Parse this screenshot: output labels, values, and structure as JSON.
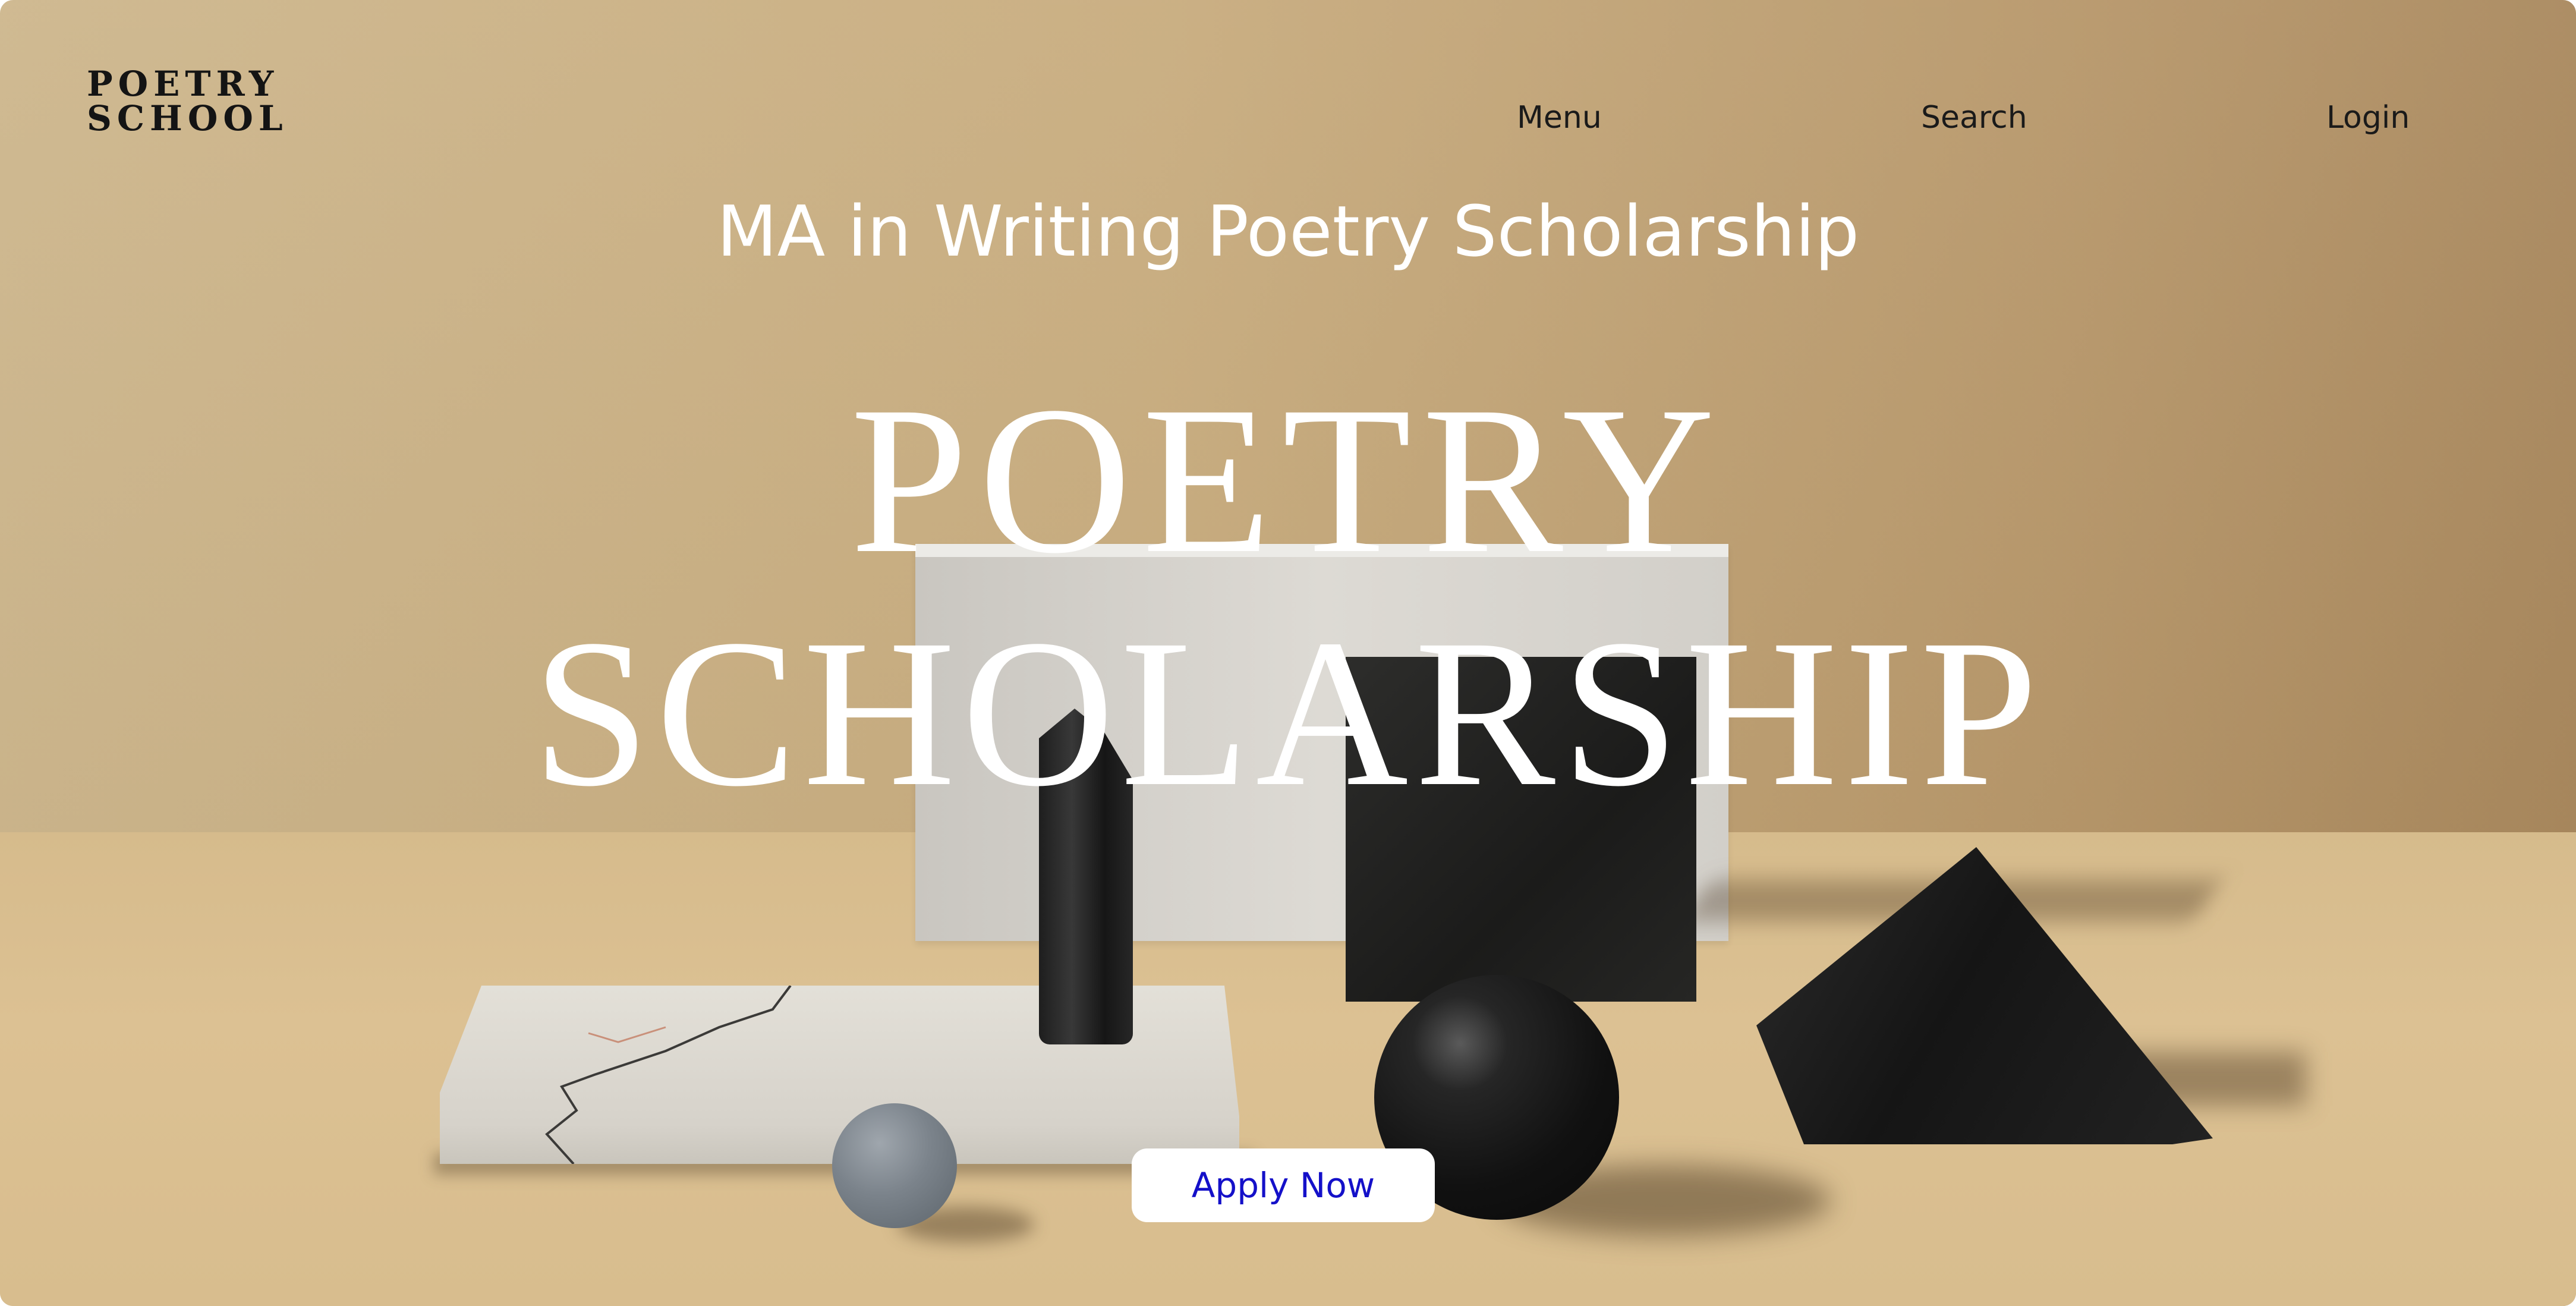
{
  "header": {
    "logo_line1": "POETRY",
    "logo_line2": "SCHOOL",
    "nav": {
      "menu_label": "Menu",
      "search_label": "Search",
      "login_label": "Login"
    }
  },
  "hero": {
    "subtitle": "MA in Writing Poetry Scholarship",
    "headline_line1": "POETRY",
    "headline_line2": "SCHOLARSHIP",
    "cta_label": "Apply Now"
  },
  "colors": {
    "background": "#c8ac7e",
    "cta_text": "#1410c9",
    "headline": "#ffffff",
    "nav_text": "#1a1a1a"
  }
}
